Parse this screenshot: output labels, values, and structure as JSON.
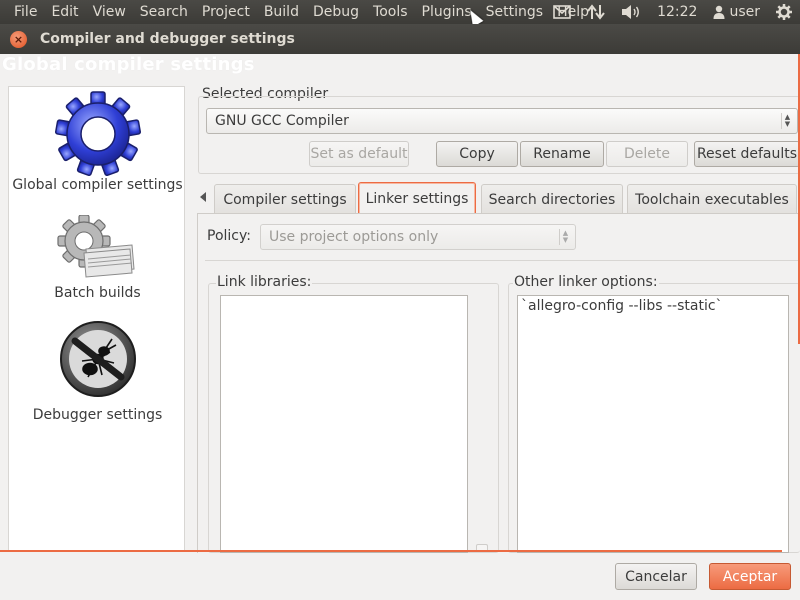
{
  "menubar": {
    "items": [
      "File",
      "Edit",
      "View",
      "Search",
      "Project",
      "Build",
      "Debug",
      "Tools",
      "Plugins",
      "Settings",
      "Help"
    ],
    "clock": "12:22",
    "user": "user"
  },
  "window": {
    "title": "Compiler and debugger settings",
    "heading": "Global compiler settings"
  },
  "sidebar": {
    "items": [
      {
        "label": "Global compiler settings",
        "icon": "gear-icon"
      },
      {
        "label": "Batch builds",
        "icon": "batch-builds-icon"
      },
      {
        "label": "Debugger settings",
        "icon": "no-bug-icon"
      }
    ]
  },
  "compiler": {
    "label": "Selected compiler",
    "value": "GNU GCC Compiler",
    "buttons": {
      "set_default": "Set as default",
      "copy": "Copy",
      "rename": "Rename",
      "delete": "Delete",
      "reset": "Reset defaults"
    }
  },
  "tabs": [
    "Compiler settings",
    "Linker settings",
    "Search directories",
    "Toolchain executables"
  ],
  "active_tab": "Linker settings",
  "linker": {
    "policy_label": "Policy:",
    "policy_value": "Use project options only",
    "link_libraries_label": "Link libraries:",
    "other_options_label": "Other linker options:",
    "other_options_value": "`allegro-config --libs --static`"
  },
  "footer": {
    "cancel": "Cancelar",
    "accept": "Aceptar"
  },
  "colors": {
    "accent": "#ec6b43",
    "panel_bg": "#3c3b37",
    "dialog_bg": "#f2f1f0"
  }
}
